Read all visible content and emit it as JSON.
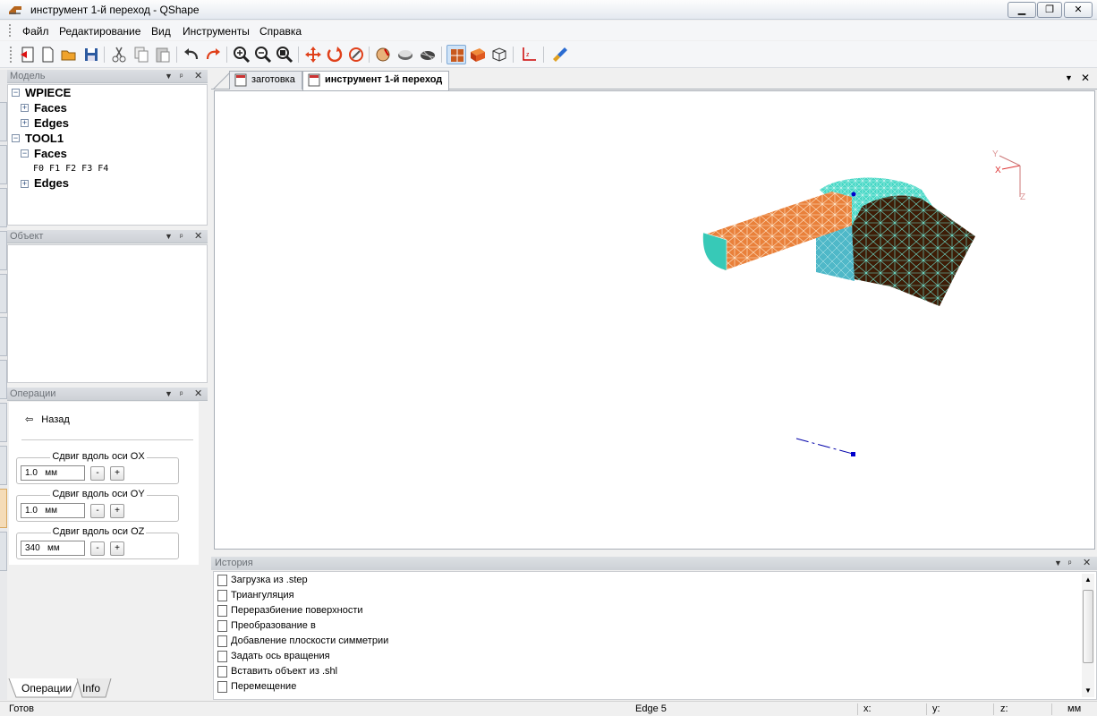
{
  "window": {
    "title": "инструмент 1-й переход - QShape"
  },
  "menu": {
    "items": [
      "Файл",
      "Редактирование",
      "Вид",
      "Инструменты",
      "Справка"
    ]
  },
  "toolbar": {
    "icons": [
      "exit-icon",
      "new-document-icon",
      "open-folder-icon",
      "save-icon",
      "cut-icon",
      "copy-icon",
      "paste-icon",
      "undo-icon",
      "redo-icon",
      "zoom-in-icon",
      "zoom-out-icon",
      "zoom-fit-icon",
      "move-icon",
      "rotate-icon",
      "rotate-view-icon",
      "measure-icon",
      "surface-icon",
      "surface-mesh-icon",
      "shaded-view-icon",
      "solid-view-icon",
      "wireframe-view-icon",
      "axes-icon",
      "brush-icon"
    ]
  },
  "panels": {
    "model": {
      "title": "Модель",
      "tree": {
        "root1": "WPIECE",
        "root1_faces": "Faces",
        "root1_edges": "Edges",
        "root2": "TOOL1",
        "root2_faces": "Faces",
        "root2_face_list": "F0 F1 F2 F3 F4",
        "root2_edges": "Edges"
      }
    },
    "object": {
      "title": "Объект"
    },
    "operations": {
      "title": "Операции",
      "back": "Назад",
      "groups": [
        {
          "label": "Сдвиг вдоль оси OX",
          "value": "1.0",
          "unit": "мм"
        },
        {
          "label": "Сдвиг вдоль оси OY",
          "value": "1.0",
          "unit": "мм"
        },
        {
          "label": "Сдвиг вдоль оси OZ",
          "value": "340",
          "unit": "мм"
        }
      ],
      "minus": "-",
      "plus": "+"
    },
    "bottom_tabs": [
      "Операции",
      "Info"
    ]
  },
  "documents": {
    "tabs": [
      {
        "label": "заготовка",
        "active": false
      },
      {
        "label": "инструмент 1-й переход",
        "active": true
      }
    ]
  },
  "viewport": {
    "axes": {
      "x": "X",
      "y": "Y",
      "z": "Z"
    },
    "colors": {
      "mesh_face": "#e9803a",
      "mesh_dark": "#3d1c06",
      "mesh_cyan": "#3fd6c4",
      "highlight": "#0000cc"
    }
  },
  "history": {
    "title": "История",
    "items": [
      "Загрузка из .step",
      "Триангуляция",
      "Переразбиение поверхности",
      "Преобразование в",
      "Добавление плоскости симметрии",
      "Задать ось вращения",
      "Вставить объект из .shl",
      "Перемещение"
    ]
  },
  "status": {
    "left": "Готов",
    "middle": "Edge 5",
    "x_label": "x:",
    "y_label": "y:",
    "z_label": "z:",
    "units": "мм"
  }
}
